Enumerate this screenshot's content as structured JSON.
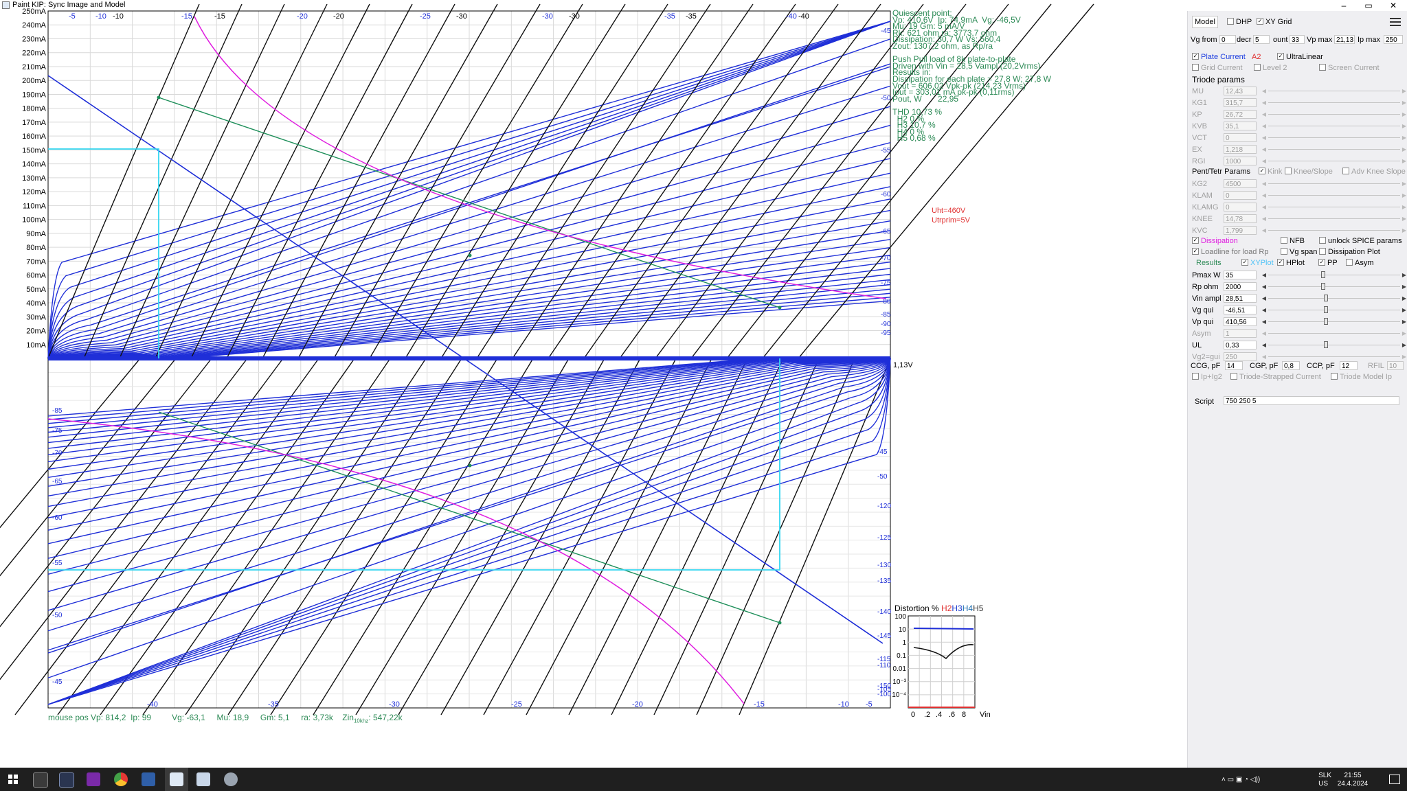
{
  "window": {
    "title": "Paint KIP: Sync Image and Model",
    "min_glyph": "–",
    "max_glyph": "▭",
    "close_glyph": "✕"
  },
  "plot": {
    "y_ticks": [
      "250mA",
      "240mA",
      "230mA",
      "220mA",
      "210mA",
      "200mA",
      "190mA",
      "180mA",
      "170mA",
      "160mA",
      "150mA",
      "140mA",
      "130mA",
      "120mA",
      "110mA",
      "100mA",
      "90mA",
      "80mA",
      "70mA",
      "60mA",
      "50mA",
      "40mA",
      "30mA",
      "20mA",
      "10mA"
    ],
    "top_labels_blue": [
      "-5",
      "-10",
      "-15",
      "-20",
      "-25",
      "-30",
      "-35",
      "-40"
    ],
    "top_labels_black": [
      "-10",
      "-15",
      "-20",
      "-30",
      "-30",
      "-35",
      "-40"
    ],
    "right_labels": [
      "-45",
      "-50",
      "-55",
      "-60",
      "-65",
      "-70",
      "-75",
      "-80",
      "-85",
      "-90",
      "-95"
    ],
    "axis_label": "1,13V",
    "bottom_labels": [
      "-40",
      "-35",
      "-30",
      "-25",
      "-20",
      "-15",
      "-10",
      "-5"
    ],
    "lower_left_labels": [
      "-85",
      "-75",
      "-70",
      "-65",
      "-60",
      "-55",
      "-50",
      "-45"
    ],
    "lower_right_labels": [
      "-45",
      "-50",
      "-120",
      "-125",
      "-130",
      "-135",
      "-140",
      "-145",
      "-115",
      "-110",
      "-150",
      "-105",
      "-100"
    ]
  },
  "info": {
    "lines": [
      "Quiescent point:",
      "Vp: 410,6V  Ip: 74,9mA  Vg: -46,5V",
      "Mu: 19 Gm: 5 mA/V",
      "Rk: 621 ohm ra: 3773,7 ohm",
      "Dissipation: 30,7 W Vs: 560,4",
      "Zout: 1307,2 ohm, as Rp/ra",
      "",
      "Push Pull load of 8k plate-to-plate",
      "Driven with Vin = 28,5 Vampl (20,2Vrms)",
      "Results in:",
      "Dissipation for each plate = 27,8 W; 27,8 W",
      "Vout = 606,02 Vpk-pk (214,23 Vrms)",
      "Iout = 303,01 mA pk-pk (0,11rms)",
      "Pout, W       22,95",
      "",
      "THD 10,73 %",
      "  H2 0 %",
      "  H3 10,7 %",
      "  H4 0 %",
      "  H5 0,68 %"
    ],
    "uht": "Uht=460V",
    "utrprim": "Utrprim=5V"
  },
  "status": {
    "mouse": "mouse pos Vp: 814,2  Ip: 99",
    "vg": "Vg: -63,1",
    "mu": "Mu: 18,9",
    "gm": "Gm: 5,1",
    "ra": "ra: 3,73k",
    "zin_prefix": "Zin",
    "zin_sub": "10khz",
    "zin_value": ": 547,22k"
  },
  "distortion": {
    "title": "Distortion %",
    "h2": "H2",
    "h3": "H3",
    "h4": "H4",
    "h5": "H5",
    "y_ticks": [
      "100",
      "10",
      "1",
      "0.1",
      "0.01",
      "10⁻³",
      "10⁻⁴"
    ],
    "x_ticks": [
      "0",
      ".2",
      ".4",
      ".6",
      "8",
      "Vin"
    ]
  },
  "panel": {
    "tab_model": "Model",
    "dhp": "DHP",
    "xy_grid": "XY Grid",
    "vg_from_label": "Vg from",
    "vg_from": "0",
    "decr_label": "decr",
    "decr": "5",
    "count_label": "ount",
    "count": "33",
    "vpmax_label": "Vp max",
    "vpmax": "21,13",
    "ipmax_label": "Ip max",
    "ipmax": "250",
    "plate_current": "Plate Current",
    "a2": "A2",
    "ultralinear": "UltraLinear",
    "grid_current": "Grid Current",
    "level2": "Level 2",
    "screen_current": "Screen Current",
    "triode_params": "Triode params",
    "triode": [
      {
        "label": "MU",
        "value": "12,43"
      },
      {
        "label": "KG1",
        "value": "315,7"
      },
      {
        "label": "KP",
        "value": "26,72"
      },
      {
        "label": "KVB",
        "value": "35,1"
      },
      {
        "label": "VCT",
        "value": "0"
      },
      {
        "label": "EX",
        "value": "1,218"
      },
      {
        "label": "RGI",
        "value": "1000"
      }
    ],
    "pent_params": "Pent/Tetr Params",
    "kink": "Kink",
    "knee_slope": "Knee/Slope",
    "adv_knee": "Adv Knee Slope",
    "pent": [
      {
        "label": "KG2",
        "value": "4500"
      },
      {
        "label": "KLAM",
        "value": "0"
      },
      {
        "label": "KLAMG",
        "value": "0"
      },
      {
        "label": "KNEE",
        "value": "14,78"
      },
      {
        "label": "KVC",
        "value": "1,799"
      }
    ],
    "dissipation": "Dissipation",
    "nfb": "NFB",
    "unlock_spice": "unlock SPICE params",
    "loadline": "Loadline for load Rp",
    "vg_span": "Vg span",
    "dissipation_plot": "Dissipation Plot",
    "results": "Results",
    "xyplot": "XYPlot",
    "hplot": "HPlot",
    "pp": "PP",
    "asym_cb": "Asym",
    "params": [
      {
        "label": "Pmax W",
        "value": "35",
        "pos": 0.4
      },
      {
        "label": "Rp ohm",
        "value": "2000",
        "pos": 0.4
      },
      {
        "label": "Vin ampl",
        "value": "28,51",
        "pos": 0.42
      },
      {
        "label": "Vg qui",
        "value": "-46,51",
        "pos": 0.42
      },
      {
        "label": "Vp qui",
        "value": "410,56",
        "pos": 0.42
      },
      {
        "label": "Asym",
        "value": "1",
        "pos": 0
      },
      {
        "label": "UL",
        "value": "0,33",
        "pos": 0.42
      },
      {
        "label": "Vg2=gui",
        "value": "250",
        "pos": 0
      }
    ],
    "ccg_label": "CCG, pF",
    "ccg": "14",
    "cgp_label": "CGP, pF",
    "cgp": "0,8",
    "ccp_label": "CCP, pF",
    "ccp": "12",
    "rfil_label": "RFIL",
    "rfil": "10",
    "ipig2": "Ip+Ig2",
    "triode_strapped": "Triode-Strapped Current",
    "triode_model": "Triode Model Ip",
    "script_label": "Script",
    "script_value": "750 250 5"
  },
  "taskbar": {
    "time": "21:55",
    "date": "24.4.2024",
    "lang1": "SLK",
    "lang2": "US"
  }
}
